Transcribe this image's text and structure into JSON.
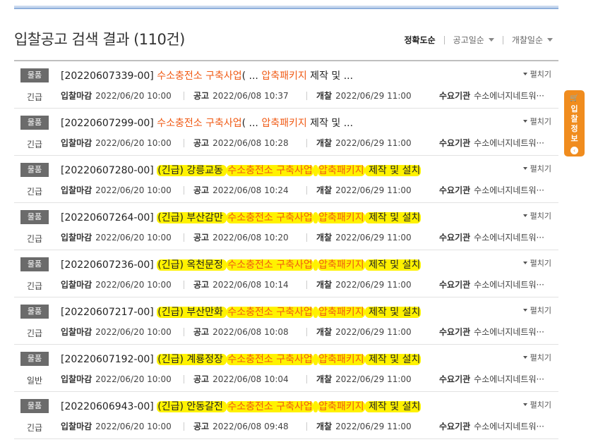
{
  "header": {
    "title": "입찰공고 검색 결과 (110건)",
    "sorts": [
      {
        "label": "정확도순",
        "active": true
      },
      {
        "label": "공고일순",
        "active": false
      },
      {
        "label": "개찰일순",
        "active": false
      }
    ]
  },
  "side_tab": {
    "icon": "🛒",
    "label": "입찰정보",
    "close": "‹"
  },
  "labels": {
    "deadline": "입찰마감",
    "notice": "공고",
    "opening": "개찰",
    "agency": "수요기관",
    "expand": "펼치기"
  },
  "rows": [
    {
      "category": "물품",
      "urgency": "긴급",
      "id": "[20220607339-00]",
      "parts": [
        [
          "hl",
          "수소충전소 구축사업"
        ],
        [
          "n",
          "( ... "
        ],
        [
          "hl",
          "압축패키지"
        ],
        [
          "n",
          " 제작 및 ..."
        ]
      ],
      "deadline": "2022/06/20 10:00",
      "notice": "2022/06/08 10:37",
      "opening": "2022/06/29 11:00",
      "agency": "수소에너지네트워···"
    },
    {
      "category": "물품",
      "urgency": "긴급",
      "id": "[20220607299-00]",
      "parts": [
        [
          "hl",
          "수소충전소 구축사업"
        ],
        [
          "n",
          "( ... "
        ],
        [
          "hl",
          "압축패키지"
        ],
        [
          "n",
          " 제작 및 ..."
        ]
      ],
      "deadline": "2022/06/20 10:00",
      "notice": "2022/06/08 10:28",
      "opening": "2022/06/29 11:00",
      "agency": "수소에너지네트워···"
    },
    {
      "category": "물품",
      "urgency": "긴급",
      "id": "[20220607280-00]",
      "parts": [
        [
          "mk",
          "(긴급) 강릉교동 "
        ],
        [
          "mkhl",
          "수소충전소 구축사업"
        ],
        [
          "mk",
          " "
        ],
        [
          "mkhl",
          "압축패키지"
        ],
        [
          "mk",
          " 제작 및 설치"
        ]
      ],
      "deadline": "2022/06/20 10:00",
      "notice": "2022/06/08 10:24",
      "opening": "2022/06/29 11:00",
      "agency": "수소에너지네트워···"
    },
    {
      "category": "물품",
      "urgency": "긴급",
      "id": "[20220607264-00]",
      "parts": [
        [
          "mk",
          "(긴급) 부산감만 "
        ],
        [
          "mkhl",
          "수소충전소 구축사업"
        ],
        [
          "mk",
          " "
        ],
        [
          "mkhl",
          "압축패키지"
        ],
        [
          "mk",
          " 제작 및 설치"
        ]
      ],
      "deadline": "2022/06/20 10:00",
      "notice": "2022/06/08 10:20",
      "opening": "2022/06/29 11:00",
      "agency": "수소에너지네트워···"
    },
    {
      "category": "물품",
      "urgency": "긴급",
      "id": "[20220607236-00]",
      "parts": [
        [
          "mk",
          "(긴급) 옥천문정 "
        ],
        [
          "mkhl",
          "수소충전소 구축사업"
        ],
        [
          "mk",
          " "
        ],
        [
          "mkhl",
          "압축패키지"
        ],
        [
          "mk",
          " 제작 및 설치"
        ]
      ],
      "deadline": "2022/06/20 10:00",
      "notice": "2022/06/08 10:14",
      "opening": "2022/06/29 11:00",
      "agency": "수소에너지네트워···"
    },
    {
      "category": "물품",
      "urgency": "긴급",
      "id": "[20220607217-00]",
      "parts": [
        [
          "mk",
          "(긴급) 부산만화 "
        ],
        [
          "mkhl",
          "수소충전소 구축사업"
        ],
        [
          "mk",
          " "
        ],
        [
          "mkhl",
          "압축패키지"
        ],
        [
          "mk",
          " 제작 및 설치"
        ]
      ],
      "deadline": "2022/06/20 10:00",
      "notice": "2022/06/08 10:08",
      "opening": "2022/06/29 11:00",
      "agency": "수소에너지네트워···"
    },
    {
      "category": "물품",
      "urgency": "일반",
      "id": "[20220607192-00]",
      "parts": [
        [
          "mk",
          "(긴급) 계룡정장 "
        ],
        [
          "mkhl",
          "수소충전소 구축사업"
        ],
        [
          "mk",
          " "
        ],
        [
          "mkhl",
          "압축패키지"
        ],
        [
          "mk",
          " 제작 및 설치"
        ]
      ],
      "deadline": "2022/06/20 10:00",
      "notice": "2022/06/08 10:04",
      "opening": "2022/06/29 11:00",
      "agency": "수소에너지네트워···"
    },
    {
      "category": "물품",
      "urgency": "긴급",
      "id": "[20220606943-00]",
      "parts": [
        [
          "mk",
          "(긴급) 안동갈전 "
        ],
        [
          "mkhl",
          "수소충전소 구축사업"
        ],
        [
          "mk",
          " "
        ],
        [
          "mkhl",
          "압축패키지"
        ],
        [
          "mk",
          " 제작 및 설치"
        ]
      ],
      "deadline": "2022/06/20 10:00",
      "notice": "2022/06/08 09:48",
      "opening": "2022/06/29 11:00",
      "agency": "수소에너지네트워···"
    }
  ]
}
